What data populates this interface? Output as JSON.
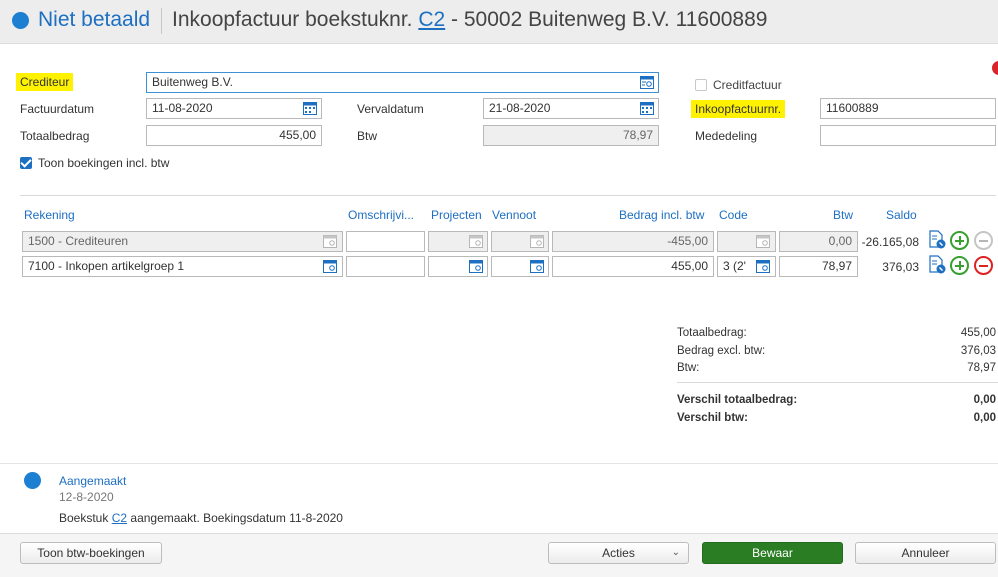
{
  "header": {
    "status": "Niet betaald",
    "title_prefix": "Inkoopfactuur boekstuknr.",
    "doc_link": "C2",
    "title_suffix": "- 50002 Buitenweg B.V. 11600889"
  },
  "form": {
    "crediteur_label": "Crediteur",
    "crediteur_value": "Buitenweg B.V.",
    "creditfactuur_label": "Creditfactuur",
    "factuurdatum_label": "Factuurdatum",
    "factuurdatum_value": "11-08-2020",
    "vervaldatum_label": "Vervaldatum",
    "vervaldatum_value": "21-08-2020",
    "inkoopfactuurnr_label": "Inkoopfactuurnr.",
    "inkoopfactuurnr_value": "11600889",
    "totaalbedrag_label": "Totaalbedrag",
    "totaalbedrag_value": "455,00",
    "btw_label": "Btw",
    "btw_value": "78,97",
    "mededeling_label": "Mededeling",
    "mededeling_value": "",
    "toon_incl_btw_label": "Toon boekingen incl. btw",
    "toon_incl_btw_checked": true,
    "creditfactuur_checked": false
  },
  "lines": {
    "columns": [
      "Rekening",
      "Omschrijvi...",
      "Projecten",
      "Vennoot",
      "Bedrag incl. btw",
      "Code",
      "Btw",
      "Saldo"
    ],
    "rows": [
      {
        "rekening": "1500 - Crediteuren",
        "omschrijving": "",
        "bedrag": "-455,00",
        "code": "",
        "btw": "0,00",
        "saldo": "-26.165,08"
      },
      {
        "rekening": "7100 - Inkopen artikelgroep 1",
        "omschrijving": "",
        "bedrag": "455,00",
        "code": "3 (2'",
        "btw": "78,97",
        "saldo": "376,03"
      }
    ]
  },
  "totals": {
    "totaalbedrag_label": "Totaalbedrag:",
    "totaalbedrag": "455,00",
    "excl_label": "Bedrag excl. btw:",
    "excl": "376,03",
    "btw_label": "Btw:",
    "btw": "78,97",
    "verschil_totaal_label": "Verschil totaalbedrag:",
    "verschil_totaal": "0,00",
    "verschil_btw_label": "Verschil btw:",
    "verschil_btw": "0,00"
  },
  "history": {
    "event": "Aangemaakt",
    "date": "12-8-2020",
    "text_prefix": "Boekstuk",
    "doc_link": "C2",
    "text_suffix": "aangemaakt. Boekingsdatum 11-8-2020"
  },
  "footer": {
    "toon_btw": "Toon btw-boekingen",
    "acties": "Acties",
    "bewaar": "Bewaar",
    "annuleer": "Annuleer"
  },
  "colors": {
    "accent": "#1d6fc2",
    "primary_button": "#2b7d24",
    "highlight": "#fff200"
  }
}
